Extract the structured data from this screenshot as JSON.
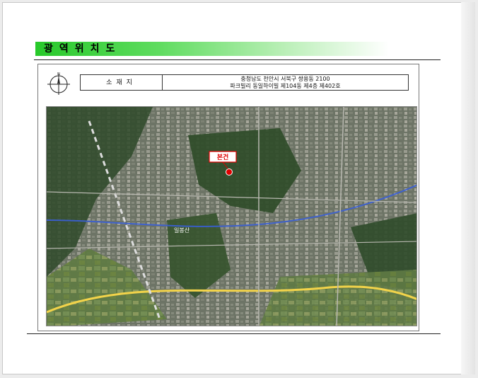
{
  "document": {
    "title": "광역위치도",
    "address_label": "소재지",
    "address_line1": "충청남도 천안시 서북구 쌍용동 2100",
    "address_line2": "파크빌리 동일하이빌 제104동 제4층 제402호",
    "compass_letter": "N"
  },
  "map": {
    "subject_marker_label": "본건",
    "place_labels": [
      "일봉산"
    ]
  },
  "colors": {
    "title_green": "#27c92a",
    "marker_red": "#e10000",
    "road_yellow": "#f2d34a",
    "road_blue": "#3a5fd8"
  }
}
